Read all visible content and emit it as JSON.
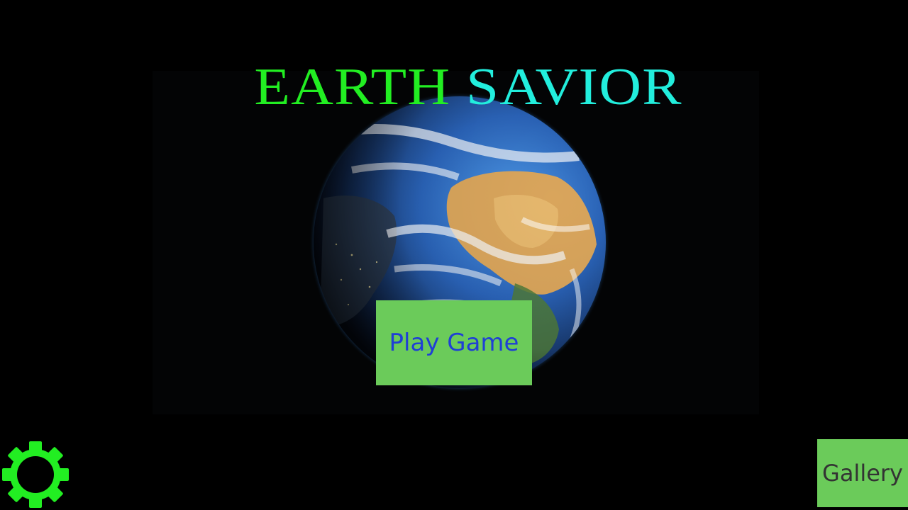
{
  "title": {
    "word1": "EARTH",
    "word2": "SAVIOR"
  },
  "menu": {
    "play_label": "Play Game",
    "gallery_label": "Gallery"
  },
  "icons": {
    "settings": "gear-icon",
    "background": "earth-globe"
  },
  "colors": {
    "title_word1": "#22ee22",
    "title_word2": "#22eedd",
    "button_bg": "#6bcb5a",
    "play_text": "#1f3fd6",
    "gallery_text": "#333333",
    "gear": "#22ee22"
  }
}
